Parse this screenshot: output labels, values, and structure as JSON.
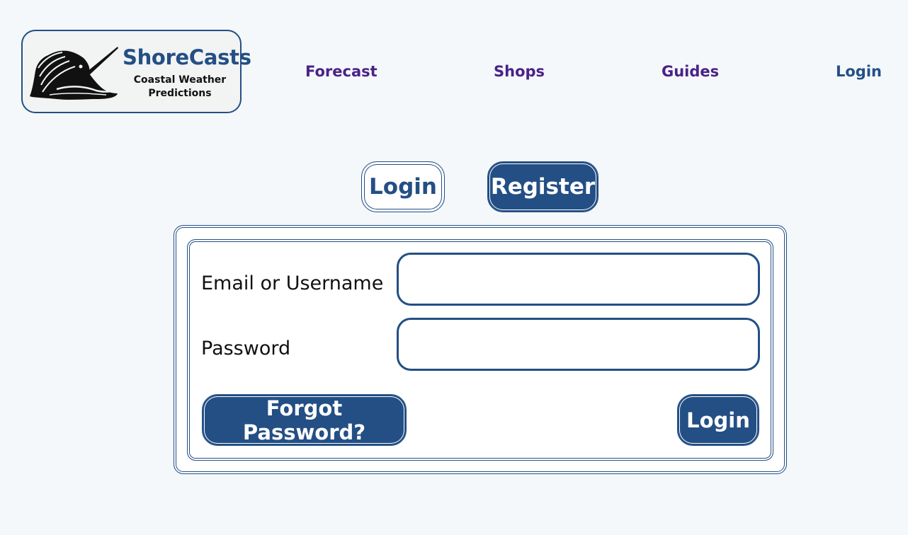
{
  "logo": {
    "title": "ShoreCasts",
    "subtitle_line1": "Coastal Weather",
    "subtitle_line2": "Predictions",
    "icon": "sailfish-icon"
  },
  "nav": {
    "forecast": "Forecast",
    "shops": "Shops",
    "guides": "Guides",
    "login": "Login"
  },
  "tabs": {
    "login": "Login",
    "register": "Register",
    "active": "register"
  },
  "form": {
    "email_label": "Email or Username",
    "email_value": "",
    "password_label": "Password",
    "password_value": "",
    "forgot_label": "Forgot Password?",
    "submit_label": "Login"
  },
  "colors": {
    "brand": "#234f85",
    "nav_link": "#4a2287",
    "background": "#f4f8fb"
  }
}
